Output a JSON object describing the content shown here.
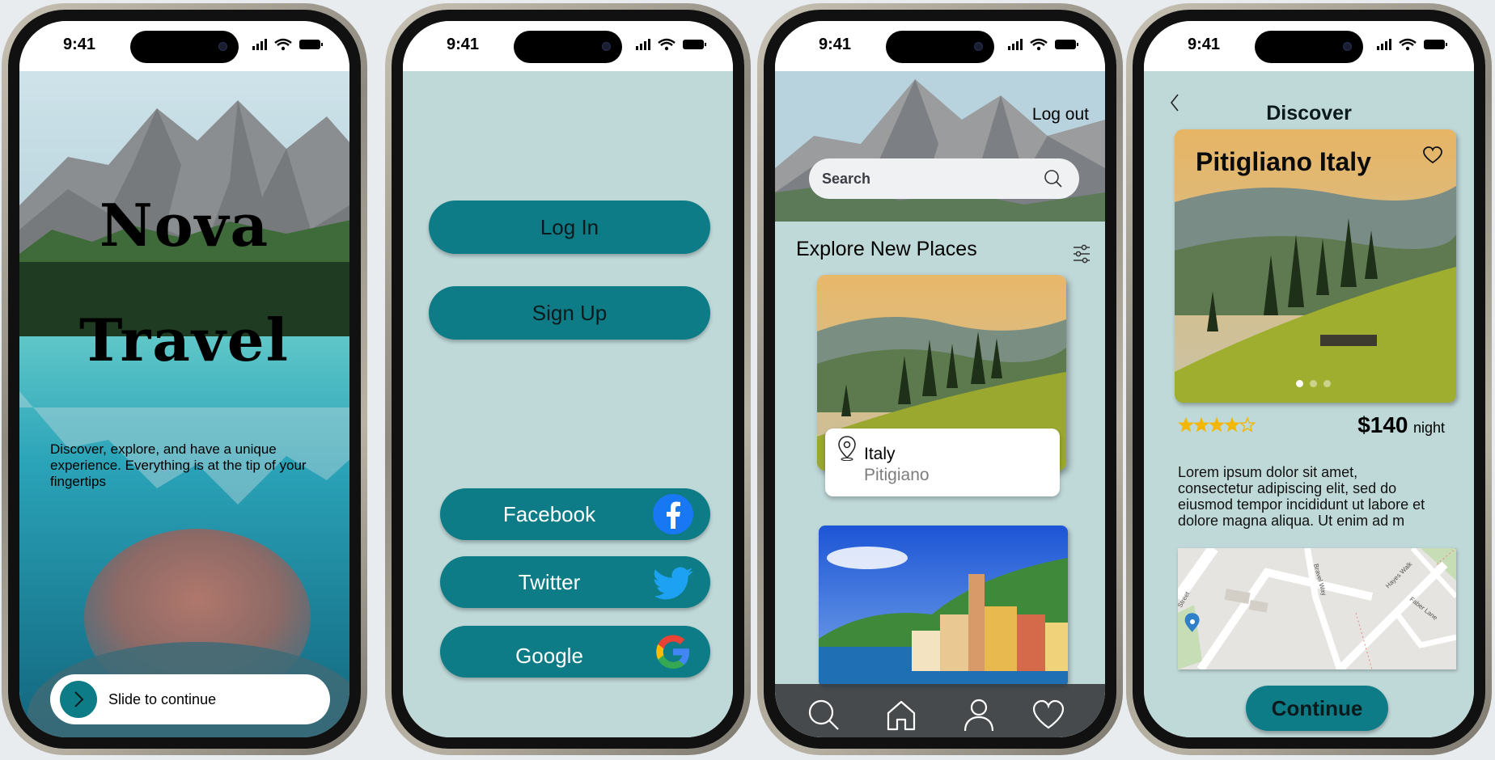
{
  "status_bar": {
    "time": "9:41"
  },
  "screen1": {
    "title_line1": "Nova",
    "title_line2": "Travel",
    "description": "Discover, explore, and have a unique experience. Everything is at the tip of your fingertips",
    "slide_label": "Slide to continue"
  },
  "screen2": {
    "login_label": "Log In",
    "signup_label": "Sign Up",
    "social": [
      {
        "label": "Facebook",
        "icon": "facebook-icon"
      },
      {
        "label": "Twitter",
        "icon": "twitter-icon"
      },
      {
        "label": "Google",
        "icon": "google-icon"
      }
    ]
  },
  "screen3": {
    "logout_label": "Log out",
    "search_placeholder": "Search",
    "section_title": "Explore New Places",
    "card1": {
      "country": "Italy",
      "city": "Pitigiano"
    },
    "tabs": [
      "search-icon",
      "home-icon",
      "profile-icon",
      "heart-icon"
    ]
  },
  "screen4": {
    "header": "Discover",
    "card_title": "Pitigliano Italy",
    "rating": 4,
    "rating_max": 5,
    "price": "$140",
    "price_unit": "night",
    "description": "Lorem ipsum dolor sit amet, consectetur adipiscing elit, sed do eiusmod tempor incididunt ut labore et dolore magna aliqua. Ut enim ad m",
    "map_streets": [
      "Street",
      "Bravel Way",
      "Hayes Walk",
      "Faber Lane"
    ],
    "continue_label": "Continue"
  },
  "colors": {
    "teal": "#0e7c86",
    "mint_bg": "#bfd8d8",
    "star": "#f2b705"
  }
}
